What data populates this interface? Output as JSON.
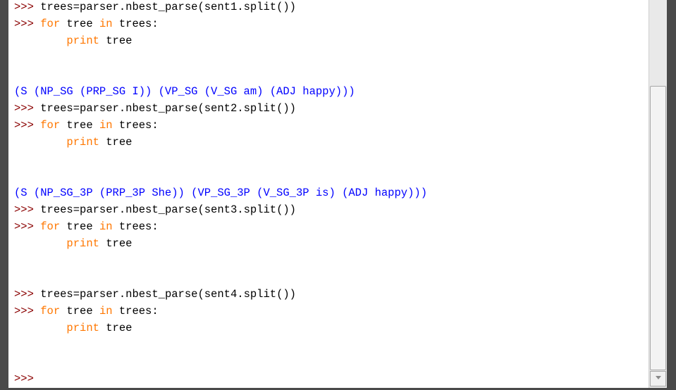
{
  "shell": {
    "lines": [
      {
        "segments": [
          {
            "t": ">>> ",
            "c": "prompt"
          },
          {
            "t": "trees=parser.nbest_parse(sent1.split())",
            "c": "plain"
          }
        ]
      },
      {
        "segments": [
          {
            "t": ">>> ",
            "c": "prompt"
          },
          {
            "t": "for",
            "c": "kw"
          },
          {
            "t": " tree ",
            "c": "plain"
          },
          {
            "t": "in",
            "c": "kw"
          },
          {
            "t": " trees:",
            "c": "plain"
          }
        ]
      },
      {
        "segments": [
          {
            "t": "        ",
            "c": "plain"
          },
          {
            "t": "print",
            "c": "kw"
          },
          {
            "t": " tree",
            "c": "plain"
          }
        ]
      },
      {
        "segments": []
      },
      {
        "segments": []
      },
      {
        "segments": [
          {
            "t": "(S (NP_SG (PRP_SG I)) (VP_SG (V_SG am) (ADJ happy)))",
            "c": "out"
          }
        ]
      },
      {
        "segments": [
          {
            "t": ">>> ",
            "c": "prompt"
          },
          {
            "t": "trees=parser.nbest_parse(sent2.split())",
            "c": "plain"
          }
        ]
      },
      {
        "segments": [
          {
            "t": ">>> ",
            "c": "prompt"
          },
          {
            "t": "for",
            "c": "kw"
          },
          {
            "t": " tree ",
            "c": "plain"
          },
          {
            "t": "in",
            "c": "kw"
          },
          {
            "t": " trees:",
            "c": "plain"
          }
        ]
      },
      {
        "segments": [
          {
            "t": "        ",
            "c": "plain"
          },
          {
            "t": "print",
            "c": "kw"
          },
          {
            "t": " tree",
            "c": "plain"
          }
        ]
      },
      {
        "segments": []
      },
      {
        "segments": []
      },
      {
        "segments": [
          {
            "t": "(S (NP_SG_3P (PRP_3P She)) (VP_SG_3P (V_SG_3P is) (ADJ happy)))",
            "c": "out"
          }
        ]
      },
      {
        "segments": [
          {
            "t": ">>> ",
            "c": "prompt"
          },
          {
            "t": "trees=parser.nbest_parse(sent3.split())",
            "c": "plain"
          }
        ]
      },
      {
        "segments": [
          {
            "t": ">>> ",
            "c": "prompt"
          },
          {
            "t": "for",
            "c": "kw"
          },
          {
            "t": " tree ",
            "c": "plain"
          },
          {
            "t": "in",
            "c": "kw"
          },
          {
            "t": " trees:",
            "c": "plain"
          }
        ]
      },
      {
        "segments": [
          {
            "t": "        ",
            "c": "plain"
          },
          {
            "t": "print",
            "c": "kw"
          },
          {
            "t": " tree",
            "c": "plain"
          }
        ]
      },
      {
        "segments": []
      },
      {
        "segments": []
      },
      {
        "segments": [
          {
            "t": ">>> ",
            "c": "prompt"
          },
          {
            "t": "trees=parser.nbest_parse(sent4.split())",
            "c": "plain"
          }
        ]
      },
      {
        "segments": [
          {
            "t": ">>> ",
            "c": "prompt"
          },
          {
            "t": "for",
            "c": "kw"
          },
          {
            "t": " tree ",
            "c": "plain"
          },
          {
            "t": "in",
            "c": "kw"
          },
          {
            "t": " trees:",
            "c": "plain"
          }
        ]
      },
      {
        "segments": [
          {
            "t": "        ",
            "c": "plain"
          },
          {
            "t": "print",
            "c": "kw"
          },
          {
            "t": " tree",
            "c": "plain"
          }
        ]
      },
      {
        "segments": []
      },
      {
        "segments": []
      },
      {
        "segments": [
          {
            "t": ">>> ",
            "c": "prompt"
          }
        ]
      }
    ]
  },
  "colors": {
    "prompt": "#8a0000",
    "keyword": "#ff7700",
    "output": "#0000ff",
    "text": "#000000",
    "background": "#ffffff",
    "frame": "#4a4a4a"
  },
  "icons": {
    "scroll_down": "triangle-down-icon"
  }
}
